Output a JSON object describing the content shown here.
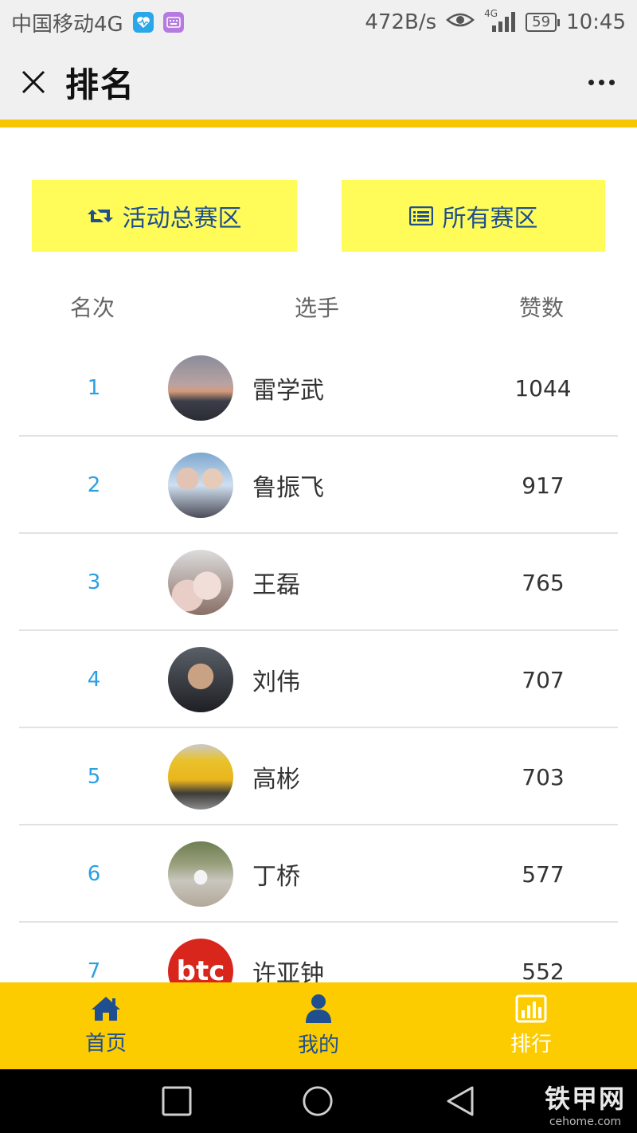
{
  "status_bar": {
    "carrier": "中国移动4G",
    "speed": "472B/s",
    "network": "4G",
    "battery": "59",
    "time": "10:45"
  },
  "header": {
    "title": "排名"
  },
  "buttons": {
    "activity_zone": "活动总赛区",
    "all_zones": "所有赛区"
  },
  "table": {
    "headers": {
      "rank": "名次",
      "player": "选手",
      "likes": "赞数"
    },
    "rows": [
      {
        "rank": "1",
        "name": "雷学武",
        "likes": "1044"
      },
      {
        "rank": "2",
        "name": "鲁振飞",
        "likes": "917"
      },
      {
        "rank": "3",
        "name": "王磊",
        "likes": "765"
      },
      {
        "rank": "4",
        "name": "刘伟",
        "likes": "707"
      },
      {
        "rank": "5",
        "name": "高彬",
        "likes": "703"
      },
      {
        "rank": "6",
        "name": "丁桥",
        "likes": "577"
      },
      {
        "rank": "7",
        "name": "许亚钟",
        "likes": "552",
        "avatar_text": "btc"
      }
    ]
  },
  "bottom_nav": {
    "home": "首页",
    "mine": "我的",
    "rank": "排行"
  },
  "watermark": {
    "main": "铁甲网",
    "sub": "cehome.com"
  },
  "colors": {
    "accent_yellow": "#fccc00",
    "button_yellow": "#fffc5a",
    "brand_blue": "#1f4f8f",
    "rank_blue": "#2aa0e3"
  }
}
